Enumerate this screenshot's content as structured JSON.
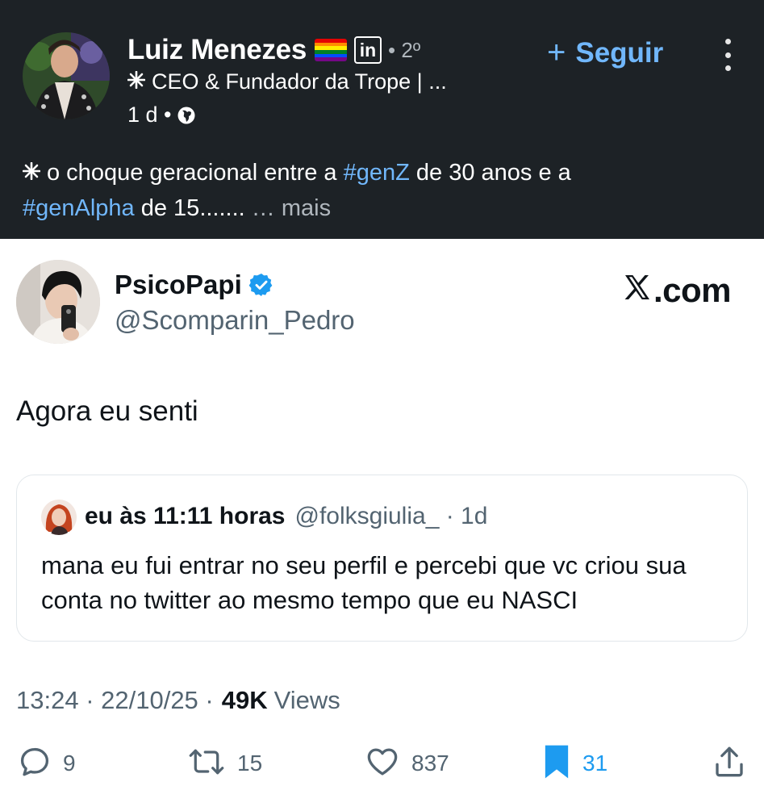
{
  "linkedin": {
    "author_name": "Luiz Menezes",
    "network_badge": "in",
    "degree": "• 2º",
    "headline": "CEO & Fundador da Trope | ...",
    "time": "1 d •",
    "follow_label": "Seguir",
    "post_text_before": "o choque geracional entre a ",
    "hashtag_1": "#genZ",
    "post_text_mid": " de 30 anos e a",
    "hashtag_2": "#genAlpha",
    "post_text_after": " de 15....... ",
    "more_label": "… mais",
    "colors": {
      "background": "#1d2226",
      "link": "#71b7fb"
    },
    "icons": [
      "rainbow-flag-icon",
      "linkedin-icon",
      "globe-icon",
      "sparkle-icon",
      "more-vertical-icon",
      "plus-icon"
    ]
  },
  "tweet": {
    "display_name": "PsicoPapi",
    "handle": "@Scomparin_Pedro",
    "source_label": ".com",
    "text": "Agora eu senti",
    "quote": {
      "name": "eu às 11:11 horas",
      "handle": "@folksgiulia_ · 1d",
      "text": "mana eu fui entrar no seu perfil e percebi que vc criou sua conta no twitter ao mesmo tempo que eu NASCI"
    },
    "meta": {
      "timestamp": "13:24 · 22/10/25 ·",
      "views_count": "49K",
      "views_label": "Views"
    },
    "actions": {
      "replies": "9",
      "retweets": "15",
      "likes": "837",
      "bookmarks": "31"
    },
    "colors": {
      "accent": "#1d9bf0",
      "text": "#0f1419",
      "muted": "#536471"
    },
    "icons": [
      "verified-icon",
      "x-logo-icon",
      "reply-icon",
      "retweet-icon",
      "like-icon",
      "bookmark-icon",
      "share-icon"
    ]
  }
}
